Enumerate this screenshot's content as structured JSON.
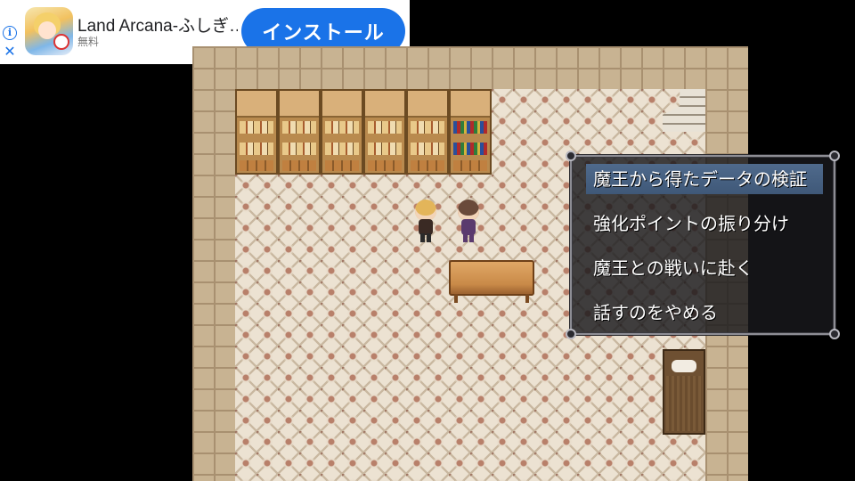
{
  "ad": {
    "app_name": "Land Arcana-ふしぎ…",
    "price": "無料",
    "install_label": "インストール",
    "info_icon": "info-icon",
    "close_icon": "close-icon",
    "accent_color": "#1a73e8"
  },
  "menu": {
    "items": [
      {
        "label": "魔王から得たデータの検証",
        "selected": true
      },
      {
        "label": "強化ポイントの振り分け",
        "selected": false
      },
      {
        "label": "魔王との戦いに赴く",
        "selected": false
      },
      {
        "label": "話すのをやめる",
        "selected": false
      }
    ],
    "highlight_color": "#4f6a8c"
  }
}
